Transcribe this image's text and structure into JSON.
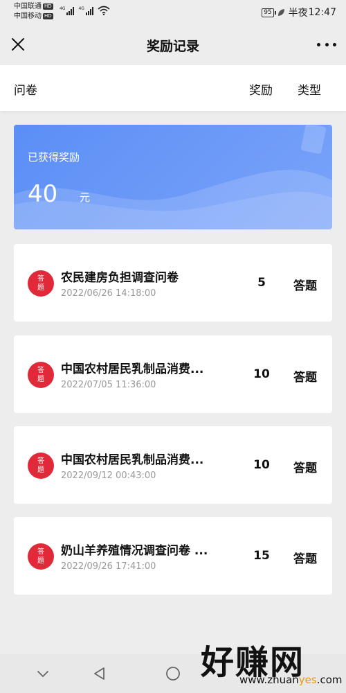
{
  "status_bar": {
    "carrier_1": "中国联通",
    "carrier_2": "中国移动",
    "hd": "HD",
    "net_type": "4G",
    "battery": "95",
    "mode": "半夜",
    "time": "12:47"
  },
  "nav": {
    "title": "奖励记录",
    "close_icon": "close-icon",
    "more_icon": "more-icon"
  },
  "header": {
    "col_name": "问卷",
    "col_reward": "奖励",
    "col_type": "类型"
  },
  "banner": {
    "label": "已获得奖励",
    "amount": "40",
    "unit": "元",
    "colors": {
      "start": "#5b8ef5",
      "end": "#7aa4fa"
    }
  },
  "records": [
    {
      "badge_line1": "答",
      "badge_line2": "题",
      "title": "农民建房负担调查问卷",
      "time": "2022/06/26 14:18:00",
      "amount": "5",
      "type": "答题"
    },
    {
      "badge_line1": "答",
      "badge_line2": "题",
      "title": "中国农村居民乳制品消费...",
      "time": "2022/07/05 11:36:00",
      "amount": "10",
      "type": "答题"
    },
    {
      "badge_line1": "答",
      "badge_line2": "题",
      "title": "中国农村居民乳制品消费...",
      "time": "2022/09/12 00:43:00",
      "amount": "10",
      "type": "答题"
    },
    {
      "badge_line1": "答",
      "badge_line2": "题",
      "title": "奶山羊养殖情况调查问卷 ...",
      "time": "2022/09/26 17:41:00",
      "amount": "15",
      "type": "答题"
    }
  ],
  "system_nav": {
    "back_icon": "chevron-down-icon",
    "triangle_icon": "back-triangle-icon",
    "home_icon": "home-circle-icon"
  },
  "watermark": {
    "big": "好赚网",
    "small_1": "www.zhuan",
    "small_2": "yes",
    "small_3": ".com"
  },
  "colors": {
    "badge": "#e02a3a",
    "background": "#ededed",
    "accent": "#5b8ef5"
  }
}
